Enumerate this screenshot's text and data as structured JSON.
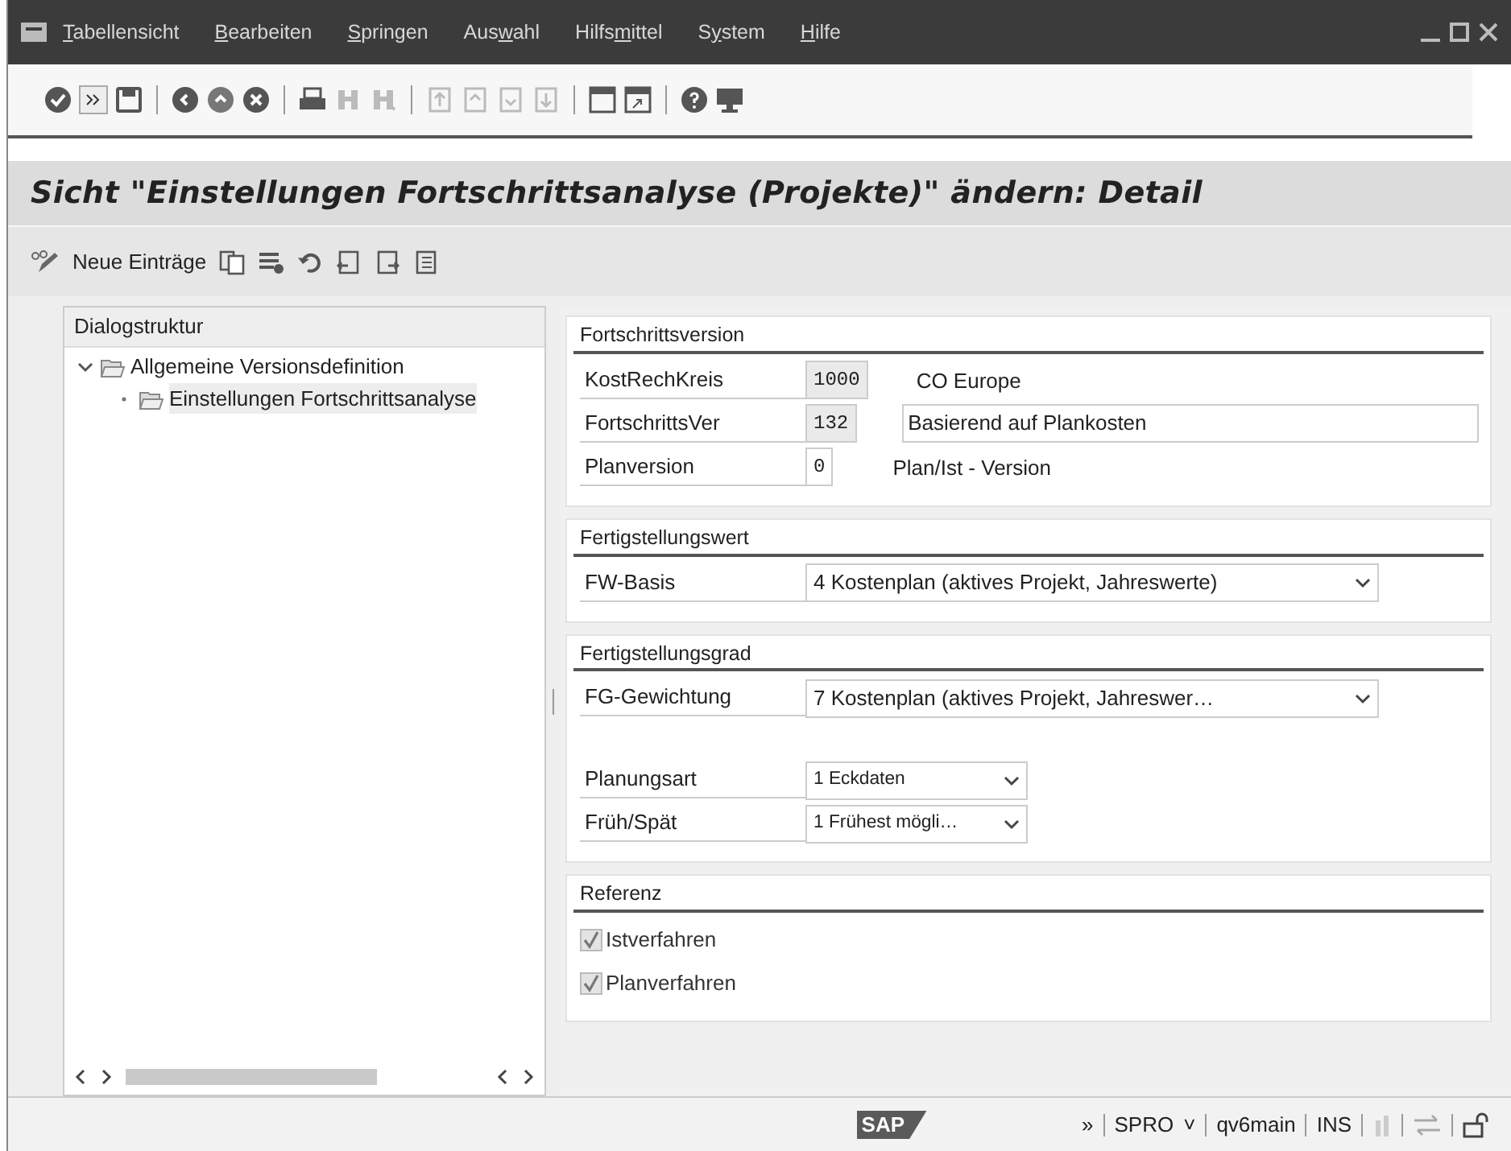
{
  "menu": [
    {
      "key": "T",
      "rest": "abellensicht"
    },
    {
      "key": "B",
      "rest": "earbeiten"
    },
    {
      "key": "S",
      "rest": "pringen"
    },
    {
      "lead": "Aus",
      "key": "w",
      "rest": "ahl"
    },
    {
      "lead": "Hilfs",
      "key": "m",
      "rest": "ittel"
    },
    {
      "lead": "S",
      "key": "y",
      "rest": "stem"
    },
    {
      "key": "H",
      "rest": "ilfe"
    }
  ],
  "page_title": "Sicht \"Einstellungen Fortschrittsanalyse (Projekte)\" ändern: Detail",
  "app_toolbar": {
    "new_entries": "Neue Einträge"
  },
  "dialog_structure": {
    "title": "Dialogstruktur",
    "items": [
      {
        "label": "Allgemeine Versionsdefinition",
        "expanded": true,
        "selected": false,
        "children": [
          {
            "label": "Einstellungen Fortschrittsanalyse",
            "selected": true
          }
        ]
      }
    ]
  },
  "groups": [
    {
      "title": "Fortschrittsversion",
      "rows": [
        {
          "kind": "field",
          "label": "KostRechKreis",
          "value": "1000",
          "readonly": true,
          "text": "CO Europe"
        },
        {
          "kind": "field",
          "label": "FortschrittsVer",
          "value": "132",
          "readonly": true,
          "text_field": "Basierend auf Plankosten"
        },
        {
          "kind": "field",
          "label": "Planversion",
          "value": "0",
          "readonly": false,
          "text": "Plan/Ist - Version"
        }
      ]
    },
    {
      "title": "Fertigstellungswert",
      "rows": [
        {
          "kind": "dropdown",
          "label": "FW-Basis",
          "value": "4 Kostenplan (aktives Projekt, Jahreswerte)"
        }
      ]
    },
    {
      "title": "Fertigstellungsgrad",
      "rows": [
        {
          "kind": "dropdown",
          "label": "FG-Gewichtung",
          "value": "7 Kostenplan (aktives Projekt, Jahreswer…"
        },
        {
          "kind": "spacer"
        },
        {
          "kind": "dropdown",
          "label": "Planungsart",
          "value": "1 Eckdaten"
        },
        {
          "kind": "dropdown",
          "label": "Früh/Spät",
          "value": "1 Frühest mögli…"
        }
      ]
    },
    {
      "title": "Referenz",
      "rows": [
        {
          "kind": "checkbox",
          "label": "Istverfahren",
          "checked": true,
          "disabled": true
        },
        {
          "kind": "checkbox",
          "label": "Planverfahren",
          "checked": true,
          "disabled": true
        }
      ]
    }
  ],
  "status_bar": {
    "logo": "SAP",
    "more": "»",
    "transaction": "SPRO",
    "caret": "˅",
    "system": "qv6main",
    "mode": "INS"
  }
}
